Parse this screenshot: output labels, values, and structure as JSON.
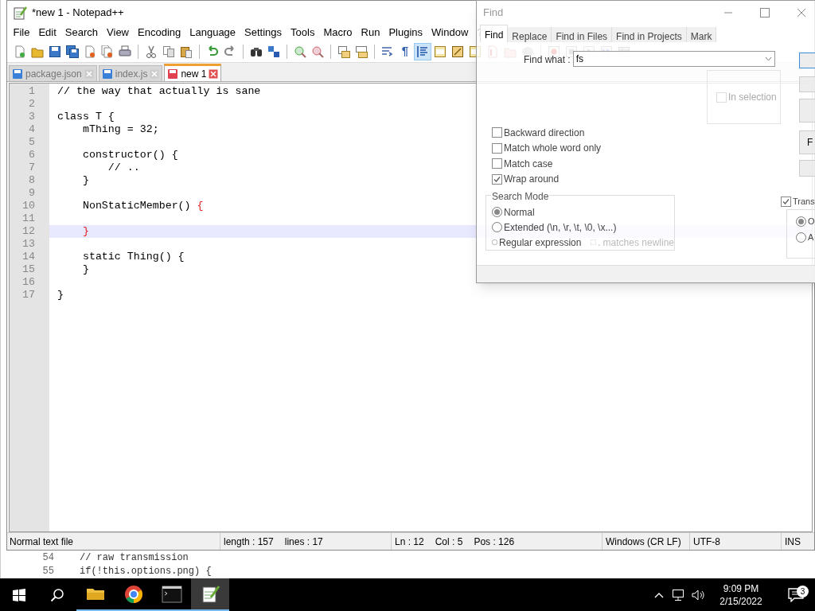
{
  "window": {
    "title": "*new 1 - Notepad++"
  },
  "menu": [
    "File",
    "Edit",
    "Search",
    "View",
    "Encoding",
    "Language",
    "Settings",
    "Tools",
    "Macro",
    "Run",
    "Plugins",
    "Window",
    "?"
  ],
  "toolbar": [
    [
      {
        "kind": "new",
        "pressed": false
      },
      {
        "kind": "open",
        "pressed": false
      },
      {
        "kind": "save",
        "pressed": false
      },
      {
        "kind": "save-all",
        "pressed": false
      },
      {
        "kind": "close",
        "pressed": false
      },
      {
        "kind": "close-all",
        "pressed": false
      },
      {
        "kind": "print",
        "pressed": false
      }
    ],
    [
      {
        "kind": "cut",
        "pressed": false
      },
      {
        "kind": "copy",
        "pressed": false
      },
      {
        "kind": "paste",
        "pressed": false
      }
    ],
    [
      {
        "kind": "undo",
        "pressed": false
      },
      {
        "kind": "redo",
        "pressed": false
      }
    ],
    [
      {
        "kind": "find",
        "pressed": false
      },
      {
        "kind": "replace",
        "pressed": false
      }
    ],
    [
      {
        "kind": "zoom-in",
        "pressed": false
      },
      {
        "kind": "zoom-out",
        "pressed": false
      }
    ],
    [
      {
        "kind": "sync-v",
        "pressed": false
      },
      {
        "kind": "sync-h",
        "pressed": false
      }
    ],
    [
      {
        "kind": "wrap",
        "pressed": false
      },
      {
        "kind": "glyph",
        "glyph": "¶",
        "pressed": false
      },
      {
        "kind": "indent",
        "pressed": true
      },
      {
        "kind": "panel",
        "pressed": false
      },
      {
        "kind": "map",
        "pressed": false
      },
      {
        "kind": "panel",
        "pressed": false
      },
      {
        "kind": "function",
        "pressed": false
      },
      {
        "kind": "folder",
        "pressed": false
      },
      {
        "kind": "monitor",
        "pressed": false
      }
    ],
    [
      {
        "kind": "record",
        "pressed": false
      },
      {
        "kind": "stop",
        "pressed": false
      },
      {
        "kind": "play",
        "pressed": false
      },
      {
        "kind": "play-multi",
        "pressed": false
      },
      {
        "kind": "save-macro",
        "pressed": false
      }
    ]
  ],
  "tabs": [
    {
      "label": "package.json",
      "selected": false,
      "modified": false
    },
    {
      "label": "index.js",
      "selected": false,
      "modified": false
    },
    {
      "label": "new 1",
      "selected": true,
      "modified": true
    }
  ],
  "editor": {
    "lines": [
      {
        "number": "1",
        "code": "// the way that actually is sane",
        "current": false
      },
      {
        "number": "2",
        "current": false
      },
      {
        "number": "3",
        "code": "class T {",
        "current": false
      },
      {
        "number": "4",
        "code": "    mThing = 32;",
        "current": false
      },
      {
        "number": "5",
        "current": false
      },
      {
        "number": "6",
        "code": "    constructor() {",
        "current": false
      },
      {
        "number": "7",
        "code": "        // ..",
        "current": false
      },
      {
        "number": "8",
        "code": "    }",
        "current": false
      },
      {
        "number": "9",
        "current": false
      },
      {
        "number": "10",
        "code": "    NonStaticMember() ",
        "brace_match": "{",
        "current": false
      },
      {
        "number": "11",
        "current": false
      },
      {
        "number": "12",
        "brace_match": "}",
        "current": true
      },
      {
        "number": "13",
        "current": false
      },
      {
        "number": "14",
        "code": "    static Thing() {",
        "current": false
      },
      {
        "number": "15",
        "code": "    }",
        "current": false
      },
      {
        "number": "16",
        "current": false
      },
      {
        "number": "17",
        "code": "}",
        "current": false
      }
    ]
  },
  "status_bar": [
    {
      "texts": [
        "Normal text file"
      ]
    },
    {
      "texts": [
        "length : 157",
        "lines : 17"
      ]
    },
    {
      "texts": [
        "Ln : 12",
        "Col : 5",
        "Pos : 126"
      ]
    },
    {
      "texts": [
        "Windows (CR LF)"
      ]
    },
    {
      "texts": [
        "UTF-8"
      ]
    },
    {
      "texts": [
        "INS"
      ]
    }
  ],
  "find_dialog": {
    "title": "Find",
    "tabs": [
      {
        "label": "Find",
        "selected": true
      },
      {
        "label": "Replace",
        "selected": false
      },
      {
        "label": "Find in Files",
        "selected": false
      },
      {
        "label": "Find in Projects",
        "selected": false
      },
      {
        "label": "Mark",
        "selected": false
      }
    ],
    "find_what": {
      "label": "Find what :",
      "value": "fs"
    },
    "in_selection": {
      "label": "In selection",
      "checked": false,
      "disabled": true
    },
    "options": [
      {
        "label": "Backward direction",
        "checked": false
      },
      {
        "label": "Match whole word only",
        "checked": false
      },
      {
        "label": "Match case",
        "checked": false
      },
      {
        "label": "Wrap around",
        "checked": true
      }
    ],
    "search_mode": {
      "title": "Search Mode",
      "modes": [
        {
          "label": "Normal",
          "selected": true
        },
        {
          "label": "Extended (\\n, \\r, \\t, \\0, \\x...)",
          "selected": false
        },
        {
          "label": "Regular expression",
          "selected": false
        }
      ],
      "matches_newline": {
        "label": ". matches newline",
        "checked": false,
        "disabled": true
      }
    },
    "buttons": [
      {
        "focused": true
      },
      {
        "focused": false
      },
      {
        "focused": false
      },
      {
        "label": "F",
        "focused": false
      },
      {
        "focused": false
      }
    ],
    "transparency": {
      "label": "Trans",
      "checked": true,
      "modes": [
        {
          "label": "O",
          "selected": true
        },
        {
          "label": "A",
          "selected": false
        }
      ]
    }
  },
  "background_window": {
    "lines": [
      {
        "number": "54",
        "code": "// raw transmission"
      },
      {
        "number": "55",
        "code": "if(!this.options.png) {"
      }
    ]
  },
  "taskbar": {
    "apps": [
      {
        "kind": "explorer",
        "selected": false
      },
      {
        "kind": "browser",
        "selected": false
      },
      {
        "kind": "terminal",
        "selected": false
      },
      {
        "kind": "notepad",
        "selected": true
      }
    ],
    "time": "9:09 PM",
    "date": "2/15/2022",
    "notifications": "3"
  }
}
